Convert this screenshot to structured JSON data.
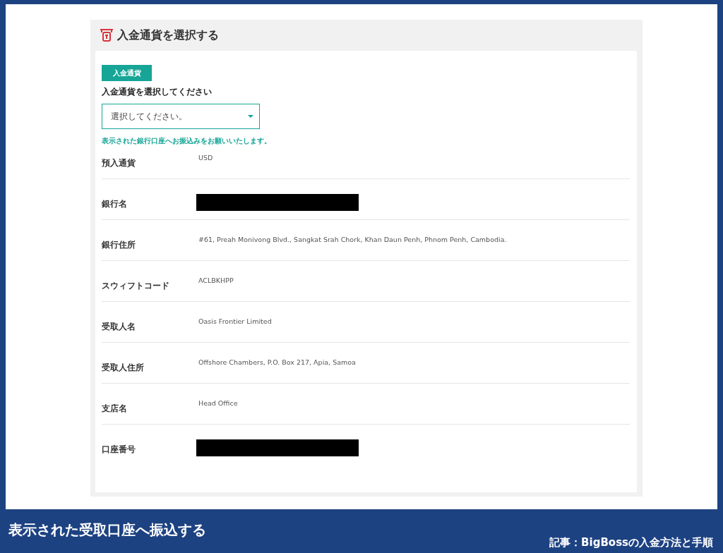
{
  "panel": {
    "title": "入金通貨を選択する"
  },
  "currency_tab": {
    "label": "入金通貨"
  },
  "select_label": "入金通貨を選択してください",
  "currency_select": {
    "placeholder": "選択してください。"
  },
  "notice": "表示された銀行口座へお振込みをお願いいたします。",
  "details": [
    {
      "kind": "text",
      "label": "預入通貨",
      "value": "USD"
    },
    {
      "kind": "redacted",
      "label": "銀行名"
    },
    {
      "kind": "text",
      "label": "銀行住所",
      "value": "#61, Preah Monivong Blvd., Sangkat Srah Chork, Khan Daun Penh, Phnom Penh, Cambodia."
    },
    {
      "kind": "text",
      "label": "スウィフトコード",
      "value": "ACLBKHPP"
    },
    {
      "kind": "text",
      "label": "受取人名",
      "value": "Oasis Frontier Limited"
    },
    {
      "kind": "text",
      "label": "受取人住所",
      "value": "Offshore Chambers, P.O. Box 217, Apia, Samoa"
    },
    {
      "kind": "text",
      "label": "支店名",
      "value": "Head Office"
    },
    {
      "kind": "redacted",
      "label": "口座番号"
    }
  ],
  "caption": "表示された受取口座へ振込する",
  "source_note": "記事：BigBossの入金方法と手順"
}
